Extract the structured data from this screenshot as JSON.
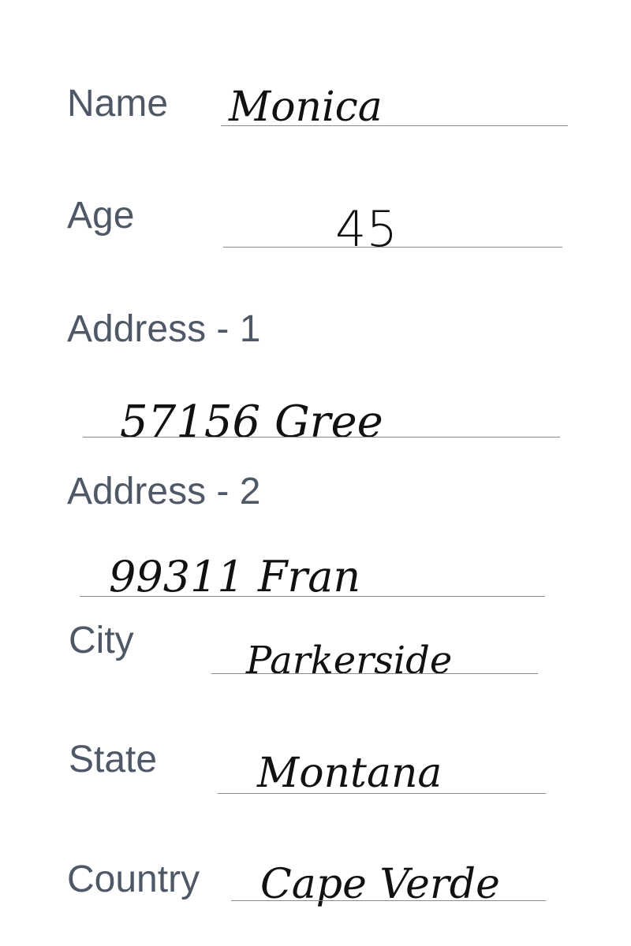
{
  "form": {
    "name": {
      "label": "Name",
      "value": "Monica"
    },
    "age": {
      "label": "Age",
      "value": "45"
    },
    "address1": {
      "label": "Address - 1",
      "value": "57156 Gree"
    },
    "address2": {
      "label": "Address - 2",
      "value": "99311 Fran"
    },
    "city": {
      "label": "City",
      "value": "Parkerside"
    },
    "state": {
      "label": "State",
      "value": "Montana"
    },
    "country": {
      "label": "Country",
      "value": "Cape Verde"
    }
  }
}
